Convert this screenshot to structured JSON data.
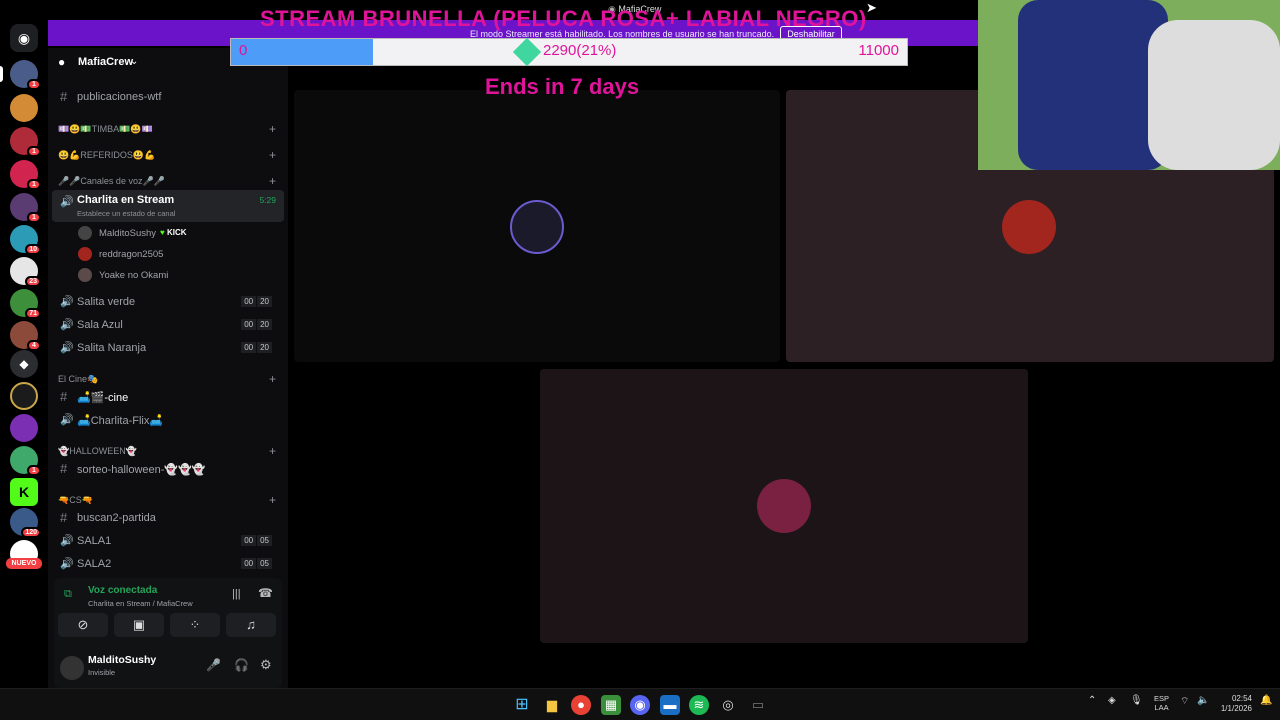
{
  "overlay": {
    "title": "STREAM BRUNELLA (PELUCA ROSA+ LABIAL NEGRO)",
    "goal_min": "0",
    "goal_current": "2290(21%)",
    "goal_progress": 0.21,
    "goal_max": "11000",
    "ends": "Ends in 7 days"
  },
  "window": {
    "title": "MafiaCrew",
    "streamer_notice": "El modo Streamer está habilitado. Los nombres de usuario se han truncado.",
    "disable_label": "Deshabilitar"
  },
  "rail": {
    "badges": [
      "1",
      "1",
      "1",
      "1",
      "10",
      "23",
      "71",
      "4",
      "1",
      "120"
    ],
    "new_label": "NUEVO"
  },
  "server": {
    "name": "MafiaCrew",
    "chevron": "chevron-down-icon"
  },
  "channels": {
    "publicaciones": "publicaciones-wtf",
    "cat_timba": "💷😃💵TIMBA💵😃💷",
    "cat_referidos": "😃💪REFERIDOS😃💪",
    "cat_voz": "🎤🎤Canales de voz🎤🎤",
    "stream_channel": "Charlita en Stream",
    "stream_status": "Establece un estado de canal",
    "stream_time": "5:29",
    "members": [
      "MalditoSushy",
      "reddragon2505",
      "Yoake no Okami"
    ],
    "kick_label": "KICK",
    "salita_verde": "Salita verde",
    "sala_azul": "Sala Azul",
    "salita_naranja": "Salita Naranja",
    "limit_users": "00",
    "limit_max": "20",
    "cat_cine": "El Cine🎭",
    "cine": "🛋️🎬-cine",
    "charlita_flix": "🛋️Charlita-Flix🛋️",
    "cat_halloween": "👻HALLOWEEN👻",
    "sorteo": "sorteo-halloween-👻👻👻",
    "cat_cs": "🔫CS🔫",
    "buscan2": "buscan2-partida",
    "sala1": "SALA1",
    "sala2": "SALA2",
    "sala_limit_max": "05"
  },
  "voice": {
    "status": "Voz conectada",
    "location": "Charlita en Stream / MafiaCrew"
  },
  "user": {
    "name": "MalditoSushy",
    "status": "Invisible"
  },
  "tray": {
    "lang1": "ESP",
    "lang2": "LAA",
    "time": "02:54",
    "date": "1/1/2026"
  },
  "colors": {
    "accent": "#e0149a",
    "progress": "#4d9cf8",
    "voice_green": "#23a55a"
  }
}
